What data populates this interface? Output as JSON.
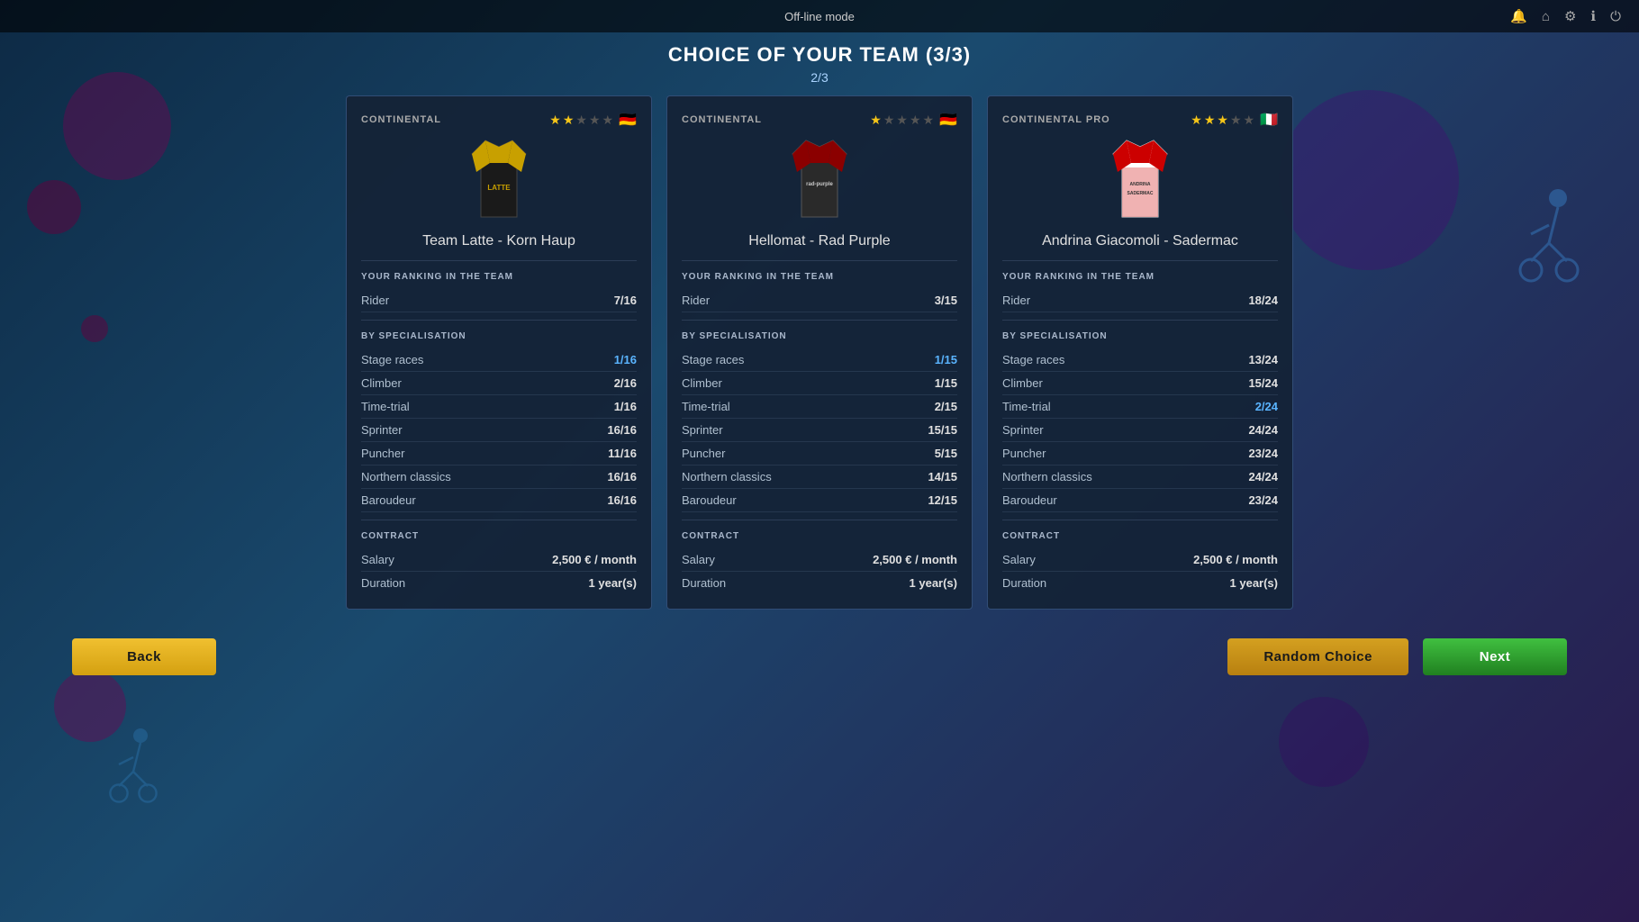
{
  "topBar": {
    "mode": "Off-line mode",
    "icons": [
      "bell",
      "home",
      "gear",
      "info",
      "power"
    ]
  },
  "header": {
    "title": "CHOICE OF YOUR TEAM (3/3)",
    "page": "2/3"
  },
  "cards": [
    {
      "id": "card-1",
      "level": "CONTINENTAL",
      "stars": [
        true,
        true,
        false,
        false,
        false
      ],
      "flag": "🇩🇪",
      "teamName": "Team Latte - Korn Haup",
      "jerseyType": "yellow",
      "ranking": {
        "sectionTitle": "YOUR RANKING IN THE TEAM",
        "rider": {
          "label": "Rider",
          "value": "7/16",
          "highlight": false
        }
      },
      "specialisation": {
        "sectionTitle": "BY SPECIALISATION",
        "items": [
          {
            "label": "Stage races",
            "value": "1/16",
            "highlight": true
          },
          {
            "label": "Climber",
            "value": "2/16",
            "highlight": false
          },
          {
            "label": "Time-trial",
            "value": "1/16",
            "highlight": false
          },
          {
            "label": "Sprinter",
            "value": "16/16",
            "highlight": false
          },
          {
            "label": "Puncher",
            "value": "11/16",
            "highlight": false
          },
          {
            "label": "Northern classics",
            "value": "16/16",
            "highlight": false
          },
          {
            "label": "Baroudeur",
            "value": "16/16",
            "highlight": false
          }
        ]
      },
      "contract": {
        "sectionTitle": "CONTRACT",
        "items": [
          {
            "label": "Salary",
            "value": "2,500 € / month",
            "highlight": false
          },
          {
            "label": "Duration",
            "value": "1 year(s)",
            "highlight": false
          }
        ]
      }
    },
    {
      "id": "card-2",
      "level": "CONTINENTAL",
      "stars": [
        true,
        false,
        false,
        false,
        false
      ],
      "flag": "🇩🇪",
      "teamName": "Hellomat - Rad Purple",
      "jerseyType": "dark-red",
      "ranking": {
        "sectionTitle": "YOUR RANKING IN THE TEAM",
        "rider": {
          "label": "Rider",
          "value": "3/15",
          "highlight": false
        }
      },
      "specialisation": {
        "sectionTitle": "BY SPECIALISATION",
        "items": [
          {
            "label": "Stage races",
            "value": "1/15",
            "highlight": true
          },
          {
            "label": "Climber",
            "value": "1/15",
            "highlight": false
          },
          {
            "label": "Time-trial",
            "value": "2/15",
            "highlight": false
          },
          {
            "label": "Sprinter",
            "value": "15/15",
            "highlight": false
          },
          {
            "label": "Puncher",
            "value": "5/15",
            "highlight": false
          },
          {
            "label": "Northern classics",
            "value": "14/15",
            "highlight": false
          },
          {
            "label": "Baroudeur",
            "value": "12/15",
            "highlight": false
          }
        ]
      },
      "contract": {
        "sectionTitle": "CONTRACT",
        "items": [
          {
            "label": "Salary",
            "value": "2,500 € / month",
            "highlight": false
          },
          {
            "label": "Duration",
            "value": "1 year(s)",
            "highlight": false
          }
        ]
      }
    },
    {
      "id": "card-3",
      "level": "CONTINENTAL PRO",
      "stars": [
        true,
        true,
        true,
        false,
        false
      ],
      "flag": "🇮🇹",
      "teamName": "Andrina Giacomoli - Sadermac",
      "jerseyType": "red-white",
      "ranking": {
        "sectionTitle": "YOUR RANKING IN THE TEAM",
        "rider": {
          "label": "Rider",
          "value": "18/24",
          "highlight": false
        }
      },
      "specialisation": {
        "sectionTitle": "BY SPECIALISATION",
        "items": [
          {
            "label": "Stage races",
            "value": "13/24",
            "highlight": false
          },
          {
            "label": "Climber",
            "value": "15/24",
            "highlight": false
          },
          {
            "label": "Time-trial",
            "value": "2/24",
            "highlight": true
          },
          {
            "label": "Sprinter",
            "value": "24/24",
            "highlight": false
          },
          {
            "label": "Puncher",
            "value": "23/24",
            "highlight": false
          },
          {
            "label": "Northern classics",
            "value": "24/24",
            "highlight": false
          },
          {
            "label": "Baroudeur",
            "value": "23/24",
            "highlight": false
          }
        ]
      },
      "contract": {
        "sectionTitle": "CONTRACT",
        "items": [
          {
            "label": "Salary",
            "value": "2,500 € / month",
            "highlight": false
          },
          {
            "label": "Duration",
            "value": "1 year(s)",
            "highlight": false
          }
        ]
      }
    }
  ],
  "buttons": {
    "back": "Back",
    "random": "Random Choice",
    "next": "Next"
  }
}
